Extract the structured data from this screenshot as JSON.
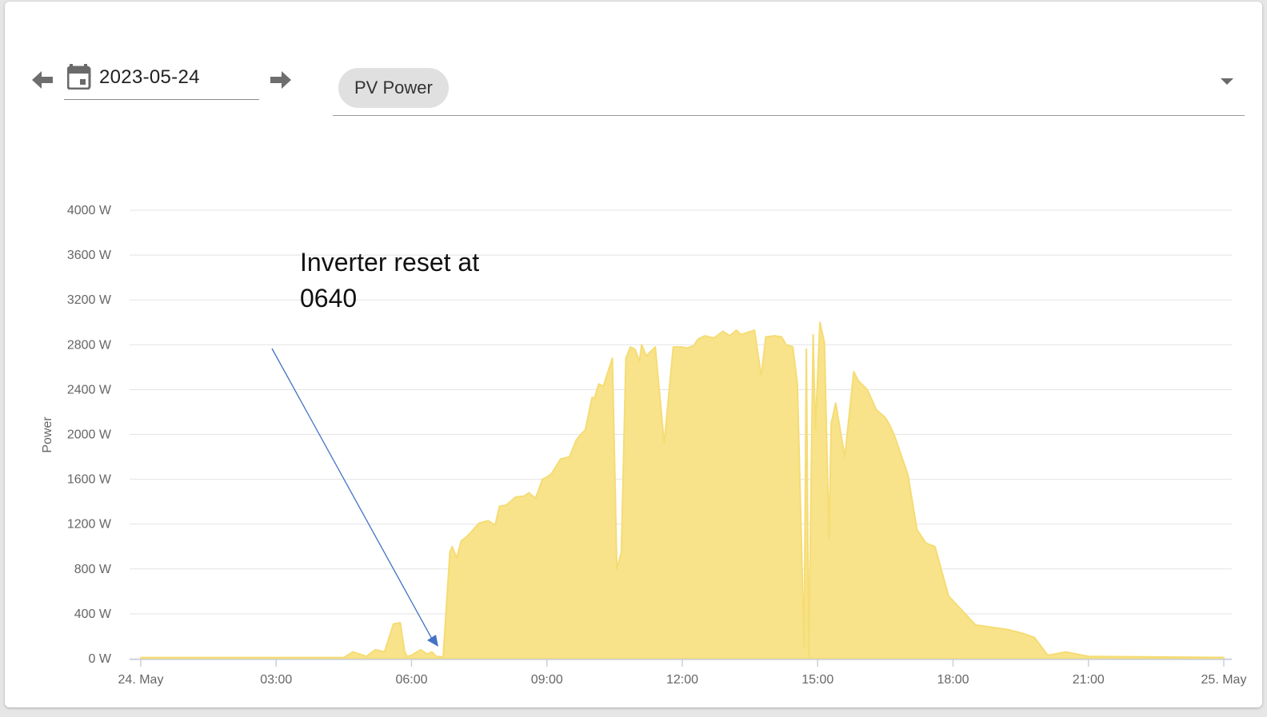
{
  "toolbar": {
    "date_value": "2023-05-24",
    "selected_chip": "PV Power"
  },
  "icons": {
    "prev": "arrow-left-icon",
    "next": "arrow-right-icon",
    "calendar": "calendar-icon",
    "dropdown": "chevron-down-icon"
  },
  "annotation": {
    "line1": "Inverter reset at",
    "line2": "0640"
  },
  "colors": {
    "area_fill": "#f8e38a",
    "area_stroke": "#f5dc74",
    "annotation_arrow": "#4472c4",
    "grid": "#e3e3e3"
  },
  "chart_data": {
    "type": "area",
    "title": "",
    "xlabel": "",
    "ylabel": "Power",
    "ylim": [
      0,
      4000
    ],
    "xlim": [
      0,
      24
    ],
    "y_ticks": [
      0,
      400,
      800,
      1200,
      1600,
      2000,
      2400,
      2800,
      3200,
      3600,
      4000
    ],
    "y_tick_labels": [
      "0 W",
      "400 W",
      "800 W",
      "1200 W",
      "1600 W",
      "2000 W",
      "2400 W",
      "2800 W",
      "3200 W",
      "3600 W",
      "4000 W"
    ],
    "x_ticks": [
      0,
      3,
      6,
      9,
      12,
      15,
      18,
      21,
      24
    ],
    "x_tick_labels": [
      "24. May",
      "03:00",
      "06:00",
      "09:00",
      "12:00",
      "15:00",
      "18:00",
      "21:00",
      "25. May"
    ],
    "grid": true,
    "legend": false,
    "series": [
      {
        "x": [
          0,
          4.5,
          4.7,
          5.0,
          5.2,
          5.4,
          5.6,
          5.75,
          5.85,
          5.9,
          6.0,
          6.2,
          6.35,
          6.45,
          6.55,
          6.7,
          6.85,
          6.9,
          7.0,
          7.1,
          7.2,
          7.3,
          7.5,
          7.7,
          7.85,
          7.95,
          8.1,
          8.3,
          8.5,
          8.6,
          8.75,
          8.9,
          9.0,
          9.1,
          9.3,
          9.5,
          9.65,
          9.75,
          9.85,
          10.0,
          10.05,
          10.15,
          10.25,
          10.45,
          10.55,
          10.65,
          10.75,
          10.85,
          10.95,
          11.05,
          11.1,
          11.2,
          11.4,
          11.6,
          11.8,
          12.0,
          12.1,
          12.25,
          12.35,
          12.5,
          12.7,
          12.9,
          13.05,
          13.2,
          13.3,
          13.6,
          13.75,
          13.85,
          14.05,
          14.2,
          14.3,
          14.45,
          14.55,
          14.7,
          14.75,
          14.8,
          14.9,
          14.95,
          15.05,
          15.15,
          15.25,
          15.3,
          15.4,
          15.6,
          15.8,
          15.9,
          16.1,
          16.3,
          16.5,
          16.6,
          16.7,
          17.0,
          17.2,
          17.4,
          17.6,
          17.9,
          18.5,
          19.2,
          19.5,
          19.65,
          19.8,
          20.1,
          20.5,
          21.0,
          24.0
        ],
        "values": [
          10,
          10,
          60,
          20,
          80,
          60,
          310,
          320,
          60,
          20,
          30,
          80,
          40,
          60,
          20,
          15,
          950,
          1000,
          900,
          1050,
          1080,
          1120,
          1210,
          1230,
          1190,
          1360,
          1370,
          1440,
          1450,
          1480,
          1430,
          1600,
          1620,
          1650,
          1780,
          1800,
          1950,
          2000,
          2040,
          2330,
          2320,
          2450,
          2430,
          2680,
          800,
          950,
          2680,
          2780,
          2760,
          2650,
          2800,
          2700,
          2780,
          1920,
          2780,
          2780,
          2770,
          2790,
          2850,
          2880,
          2860,
          2920,
          2880,
          2930,
          2890,
          2930,
          2520,
          2870,
          2880,
          2870,
          2800,
          2780,
          2450,
          100,
          2760,
          20,
          2890,
          2050,
          3000,
          2820,
          1080,
          2100,
          2280,
          1800,
          2560,
          2480,
          2400,
          2220,
          2150,
          2080,
          1990,
          1640,
          1150,
          1030,
          1000,
          560,
          300,
          260,
          230,
          210,
          190,
          30,
          60,
          20,
          10
        ]
      }
    ]
  }
}
